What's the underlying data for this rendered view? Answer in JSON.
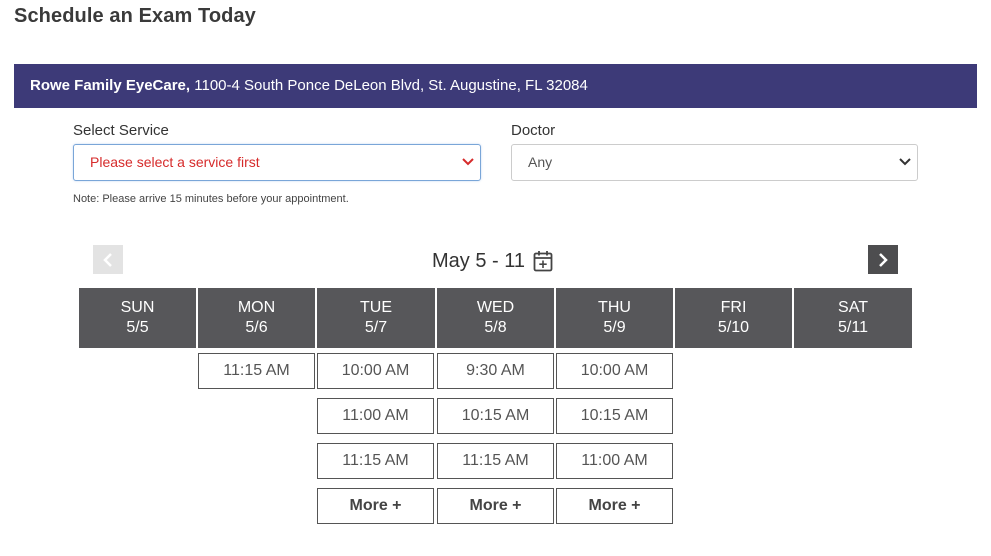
{
  "page": {
    "title": "Schedule an Exam Today"
  },
  "location": {
    "practice": "Rowe Family EyeCare,",
    "address": " 1100-4 South Ponce DeLeon Blvd, St. Augustine, FL 32084"
  },
  "form": {
    "service_label": "Select Service",
    "service_value": "Please select a service first",
    "doctor_label": "Doctor",
    "doctor_value": "Any",
    "note": "Note: Please arrive 15 minutes before your appointment."
  },
  "calendar": {
    "week_label": "May 5 - 11",
    "days": [
      {
        "name": "SUN",
        "date": "5/5",
        "slots": []
      },
      {
        "name": "MON",
        "date": "5/6",
        "slots": [
          "11:15 AM"
        ]
      },
      {
        "name": "TUE",
        "date": "5/7",
        "slots": [
          "10:00 AM",
          "11:00 AM",
          "11:15 AM"
        ],
        "more": "More +"
      },
      {
        "name": "WED",
        "date": "5/8",
        "slots": [
          "9:30 AM",
          "10:15 AM",
          "11:15 AM"
        ],
        "more": "More +"
      },
      {
        "name": "THU",
        "date": "5/9",
        "slots": [
          "10:00 AM",
          "10:15 AM",
          "11:00 AM"
        ],
        "more": "More +"
      },
      {
        "name": "FRI",
        "date": "5/10",
        "slots": []
      },
      {
        "name": "SAT",
        "date": "5/11",
        "slots": []
      }
    ]
  },
  "icons": {
    "prev": "chevron-left-icon",
    "next": "chevron-right-icon",
    "calendar": "calendar-plus-icon",
    "dropdown": "chevron-down-icon"
  },
  "colors": {
    "location_bar": "#3d3a78",
    "day_header": "#57575a",
    "placeholder_text": "#d62b2b",
    "next_button": "#4d4d4f",
    "prev_button": "#e3e3e3"
  }
}
